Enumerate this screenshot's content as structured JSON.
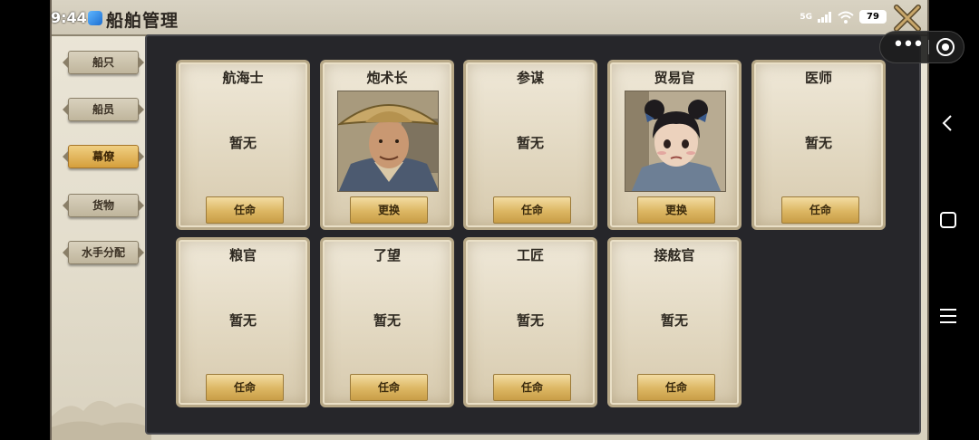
{
  "status_bar": {
    "time": "9:44",
    "signal": "5G",
    "battery": "79"
  },
  "header": {
    "title": "船舶管理"
  },
  "sidebar": {
    "items": [
      {
        "label": "船只",
        "active": false
      },
      {
        "label": "船员",
        "active": false
      },
      {
        "label": "幕僚",
        "active": true
      },
      {
        "label": "货物",
        "active": false
      },
      {
        "label": "水手分配",
        "active": false
      }
    ]
  },
  "advisors": [
    {
      "title": "航海士",
      "empty_text": "暂无",
      "action": "任命"
    },
    {
      "title": "炮术长",
      "portrait": "man-with-straw-hat",
      "action": "更换"
    },
    {
      "title": "参谋",
      "empty_text": "暂无",
      "action": "任命"
    },
    {
      "title": "贸易官",
      "portrait": "girl-with-hair-buns",
      "action": "更换"
    },
    {
      "title": "医师",
      "empty_text": "暂无",
      "action": "任命"
    },
    {
      "title": "粮官",
      "empty_text": "暂无",
      "action": "任命"
    },
    {
      "title": "了望",
      "empty_text": "暂无",
      "action": "任命"
    },
    {
      "title": "工匠",
      "empty_text": "暂无",
      "action": "任命"
    },
    {
      "title": "接舷官",
      "empty_text": "暂无",
      "action": "任命"
    }
  ],
  "colors": {
    "active_tab": "#d59f3c",
    "panel_bg": "#26262a",
    "card_border": "#b7a887"
  }
}
